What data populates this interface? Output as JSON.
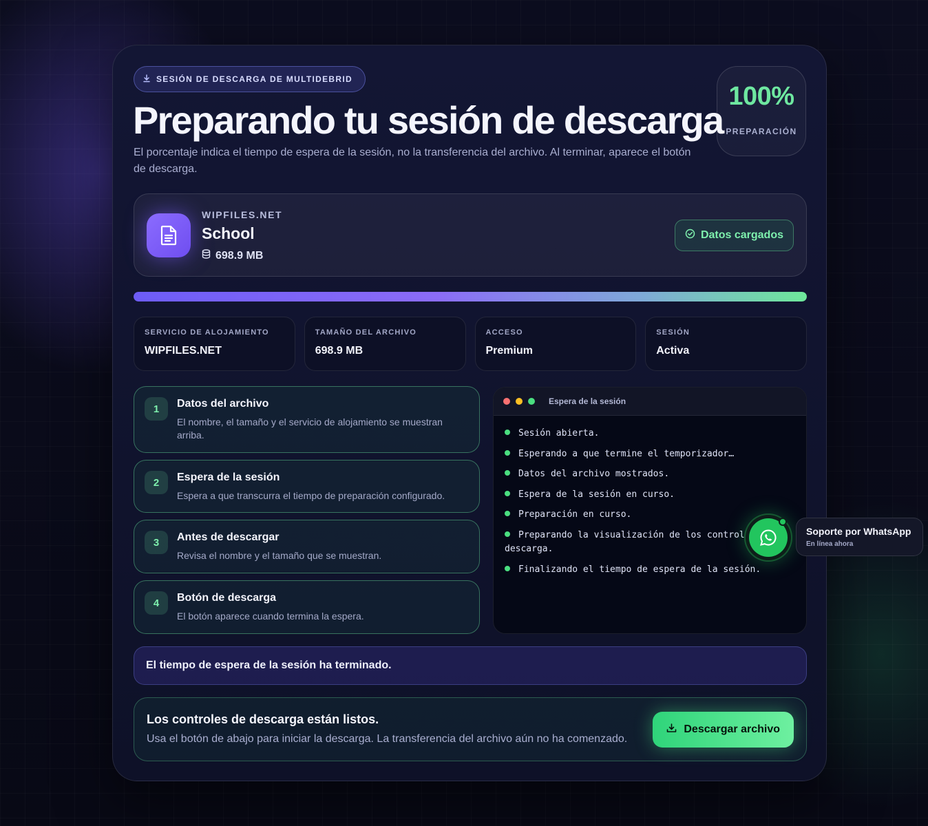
{
  "colors": {
    "accent_green": "#6ee7a0",
    "accent_purple": "#7c5cff",
    "background": "#0c0d1f",
    "card": "#131634"
  },
  "header": {
    "badge_icon": "download-spark-icon",
    "badge": "SESIÓN DE DESCARGA DE MULTIDEBRID",
    "title": "Preparando tu sesión de descarga",
    "subtitle": "El porcentaje indica el tiempo de espera de la sesión, no la transferencia del archivo. Al terminar, aparece el botón de descarga."
  },
  "preparation": {
    "value": "100%",
    "label": "PREPARACIÓN"
  },
  "file": {
    "icon": "document-icon",
    "host": "WIPFILES.NET",
    "name": "School",
    "size_icon": "database-icon",
    "size": "698.9 MB",
    "status_icon": "check-circle-icon",
    "status": "Datos cargados"
  },
  "progress": {
    "fraction": 1.0
  },
  "stats": [
    {
      "label": "SERVICIO DE ALOJAMIENTO",
      "value": "WIPFILES.NET"
    },
    {
      "label": "TAMAÑO DEL ARCHIVO",
      "value": "698.9 MB"
    },
    {
      "label": "ACCESO",
      "value": "Premium"
    },
    {
      "label": "SESIÓN",
      "value": "Activa"
    }
  ],
  "steps": [
    {
      "num": "1",
      "title": "Datos del archivo",
      "desc": "El nombre, el tamaño y el servicio de alojamiento se muestran arriba."
    },
    {
      "num": "2",
      "title": "Espera de la sesión",
      "desc": "Espera a que transcurra el tiempo de preparación configurado."
    },
    {
      "num": "3",
      "title": "Antes de descargar",
      "desc": "Revisa el nombre y el tamaño que se muestran."
    },
    {
      "num": "4",
      "title": "Botón de descarga",
      "desc": "El botón aparece cuando termina la espera."
    }
  ],
  "terminal": {
    "title": "Espera de la sesión",
    "dot_colors": [
      "#f87171",
      "#fbbf24",
      "#4ade80"
    ],
    "lines": [
      "Sesión abierta.",
      "Esperando a que termine el temporizador…",
      "Datos del archivo mostrados.",
      "Espera de la sesión en curso.",
      "Preparación en curso.",
      "Preparando la visualización de los controles de descarga.",
      "Finalizando el tiempo de espera de la sesión."
    ]
  },
  "notice": "El tiempo de espera de la sesión ha terminado.",
  "ready": {
    "title": "Los controles de descarga están listos.",
    "desc": "Usa el botón de abajo para iniciar la descarga. La transferencia del archivo aún no ha comenzado.",
    "button_icon": "download-icon",
    "button": "Descargar archivo"
  },
  "whatsapp": {
    "icon": "whatsapp-icon",
    "title": "Soporte por WhatsApp",
    "status": "En línea ahora"
  }
}
